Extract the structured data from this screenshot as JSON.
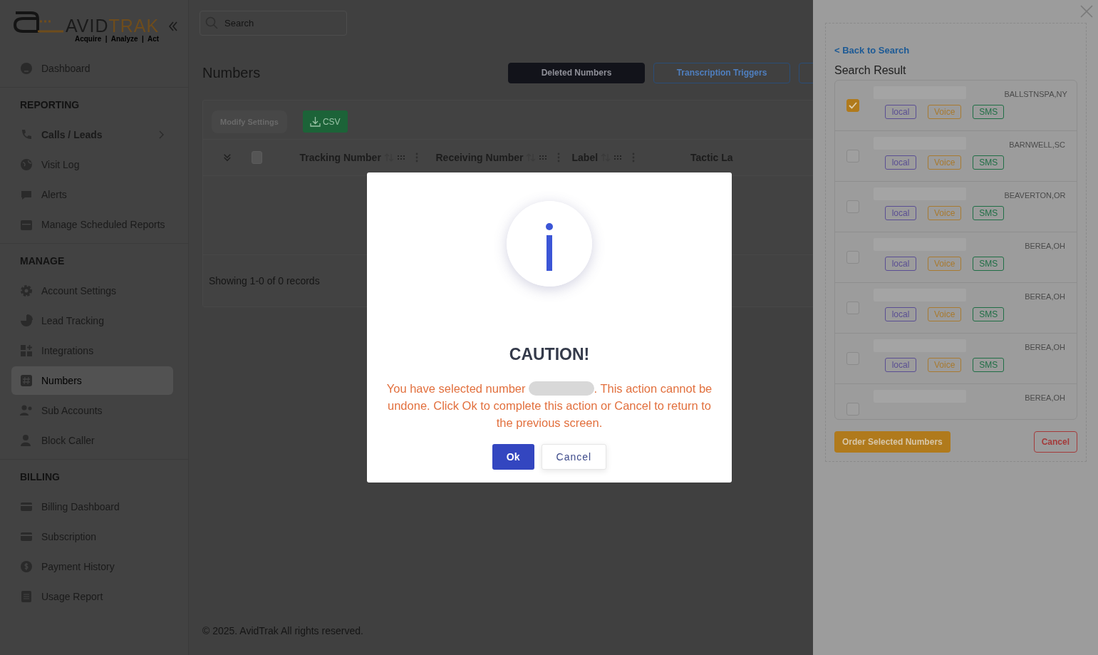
{
  "sidebar": {
    "logo": {
      "word_1": "AVID",
      "word_2": "TRAK",
      "tagline": "Acquire  |  Analyze  |  Act"
    },
    "sections": [
      {
        "items": [
          {
            "label": "Dashboard",
            "kind": "link",
            "selected": false
          }
        ]
      },
      {
        "title": "REPORTING",
        "items": [
          {
            "label": "Calls / Leads",
            "kind": "group",
            "selected": false
          },
          {
            "label": "Visit Log",
            "kind": "link",
            "selected": false
          },
          {
            "label": "Alerts",
            "kind": "link",
            "selected": false
          },
          {
            "label": "Manage Scheduled Reports",
            "kind": "link",
            "selected": false
          }
        ]
      },
      {
        "title": "MANAGE",
        "items": [
          {
            "label": "Account Settings",
            "kind": "link",
            "selected": false
          },
          {
            "label": "Lead Tracking",
            "kind": "link",
            "selected": false
          },
          {
            "label": "Integrations",
            "kind": "link",
            "selected": false
          },
          {
            "label": "Numbers",
            "kind": "link",
            "selected": true
          },
          {
            "label": "Sub Accounts",
            "kind": "link",
            "selected": false
          },
          {
            "label": "Block Caller",
            "kind": "link",
            "selected": false
          }
        ]
      },
      {
        "title": "BILLING",
        "items": [
          {
            "label": "Billing Dashboard",
            "kind": "link",
            "selected": false
          },
          {
            "label": "Subscription",
            "kind": "link",
            "selected": false
          },
          {
            "label": "Payment History",
            "kind": "link",
            "selected": false
          },
          {
            "label": "Usage Report",
            "kind": "link",
            "selected": false
          }
        ]
      }
    ]
  },
  "topbar": {
    "search": {
      "placeholder": "Search"
    }
  },
  "page": {
    "title": "Numbers",
    "actions": [
      {
        "label": "Deleted Numbers",
        "kind": "dark"
      },
      {
        "label": "Transcription Triggers",
        "kind": "outline"
      },
      {
        "kind": "outline"
      }
    ]
  },
  "table": {
    "modify_button": {
      "label": "Modify Settings",
      "disabled": true
    },
    "export_button": {
      "label": "CSV"
    },
    "header_checkbox": {
      "checked": false
    },
    "columns": [
      "Tracking Number",
      "Receiving Number",
      "Label",
      "Tactic La"
    ],
    "summary": "Showing 1-0 of 0 records"
  },
  "footer": "© 2025. AvidTrak All rights reserved.",
  "drawer": {
    "back_link": "< Back to Search",
    "title": "Search Result",
    "results": [
      {
        "checked": true,
        "city": "BALLSTNSPA,NY",
        "tags": [
          {
            "label": "local",
            "color": "#5a4e93"
          },
          {
            "label": "Voice",
            "color": "#a87a30"
          },
          {
            "label": "SMS",
            "color": "#1f6e45"
          }
        ]
      },
      {
        "checked": false,
        "city": "BARNWELL,SC",
        "tags": [
          {
            "label": "local",
            "color": "#5a4e93"
          },
          {
            "label": "Voice",
            "color": "#a87a30"
          },
          {
            "label": "SMS",
            "color": "#1f6e45"
          }
        ]
      },
      {
        "checked": false,
        "city": "BEAVERTON,OR",
        "tags": [
          {
            "label": "local",
            "color": "#5a4e93"
          },
          {
            "label": "Voice",
            "color": "#a87a30"
          },
          {
            "label": "SMS",
            "color": "#1f6e45"
          }
        ]
      },
      {
        "checked": false,
        "city": "BEREA,OH",
        "tags": [
          {
            "label": "local",
            "color": "#5a4e93"
          },
          {
            "label": "Voice",
            "color": "#a87a30"
          },
          {
            "label": "SMS",
            "color": "#1f6e45"
          }
        ]
      },
      {
        "checked": false,
        "city": "BEREA,OH",
        "tags": [
          {
            "label": "local",
            "color": "#5a4e93"
          },
          {
            "label": "Voice",
            "color": "#a87a30"
          },
          {
            "label": "SMS",
            "color": "#1f6e45"
          }
        ]
      },
      {
        "checked": false,
        "city": "BEREA,OH",
        "tags": [
          {
            "label": "local",
            "color": "#5a4e93"
          },
          {
            "label": "Voice",
            "color": "#a87a30"
          },
          {
            "label": "SMS",
            "color": "#1f6e45"
          }
        ]
      },
      {
        "checked": false,
        "city": "BEREA,OH"
      }
    ],
    "order_button": "Order Selected Numbers",
    "cancel_button": "Cancel"
  },
  "dialog": {
    "title": "CAUTION!",
    "message_before": "You have selected number",
    "message_after": ". This action cannot be undone. Click Ok to complete this action or Cancel to return to the previous screen.",
    "buttons": [
      {
        "label": "Ok",
        "kind": "primary"
      },
      {
        "label": "Cancel",
        "kind": "secondary"
      }
    ]
  }
}
